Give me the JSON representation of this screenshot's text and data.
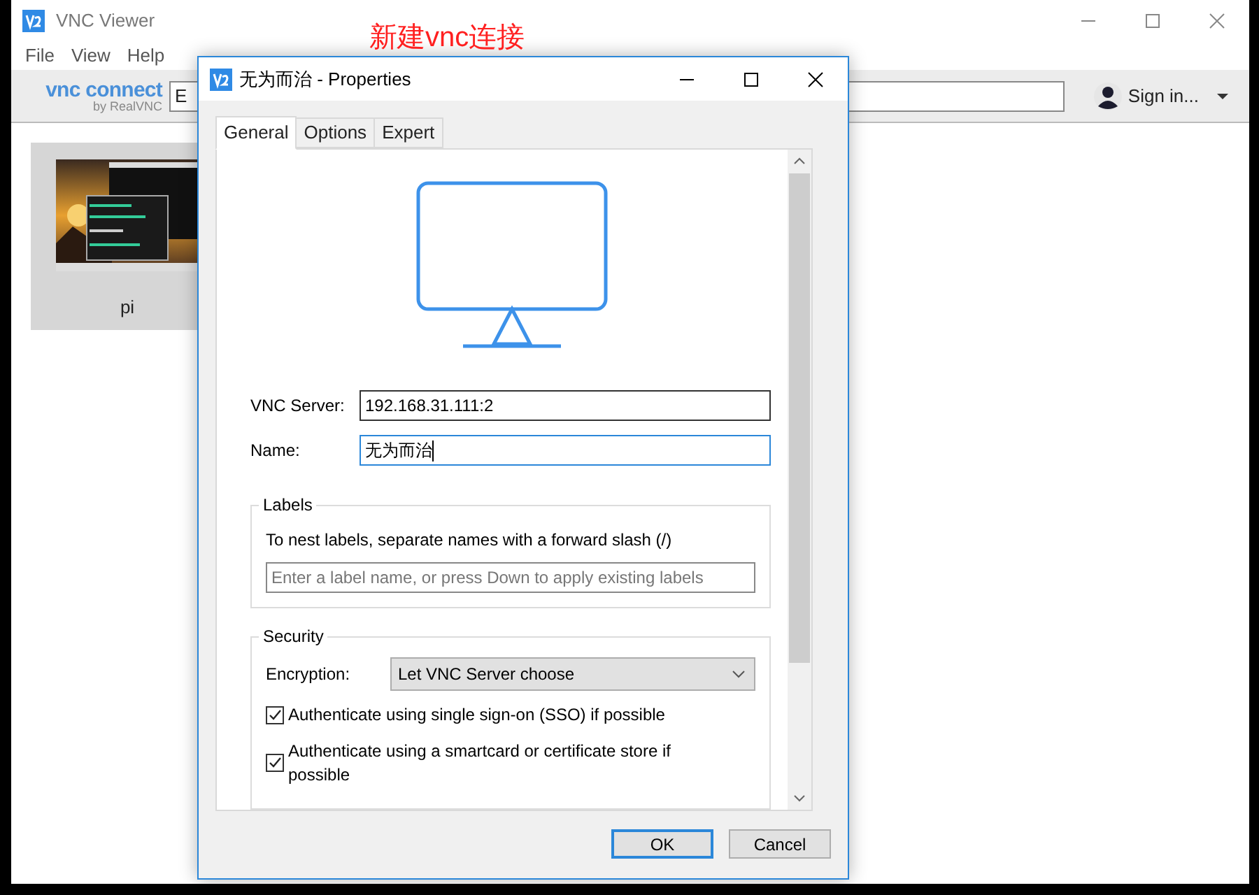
{
  "main_window": {
    "title": "VNC Viewer",
    "menu": [
      "File",
      "View",
      "Help"
    ],
    "logo": {
      "name": "vnc connect",
      "byline": "by RealVNC"
    },
    "search": {
      "value": "E"
    },
    "sign_in": "Sign in...",
    "computers": [
      {
        "name": "pi",
        "kind": "picture",
        "selected": true
      }
    ]
  },
  "annotation": "新建vnc连接",
  "dialog": {
    "title": "无为而治 - Properties",
    "tabs": [
      {
        "label": "General",
        "selected": true
      },
      {
        "label": "Options",
        "selected": false
      },
      {
        "label": "Expert",
        "selected": false
      }
    ],
    "fields": [
      {
        "label": "VNC Server:",
        "value": "192.168.31.111:2",
        "focused": false
      },
      {
        "label": "Name:",
        "value": "无为而治",
        "focused": true
      }
    ],
    "labels_group": {
      "title": "Labels",
      "hint": "To nest labels, separate names with a forward slash (/)",
      "placeholder": "Enter a label name, or press Down to apply existing labels"
    },
    "security_group": {
      "title": "Security",
      "encryption_label": "Encryption:",
      "encryption_value": "Let VNC Server choose",
      "checkboxes": [
        {
          "label": "Authenticate using single sign-on (SSO) if possible",
          "checked": true
        },
        {
          "label": "Authenticate using a smartcard or certificate store if possible",
          "checked": true
        }
      ]
    },
    "buttons": [
      {
        "label": "OK",
        "selected": true
      },
      {
        "label": "Cancel",
        "selected": false
      }
    ]
  }
}
